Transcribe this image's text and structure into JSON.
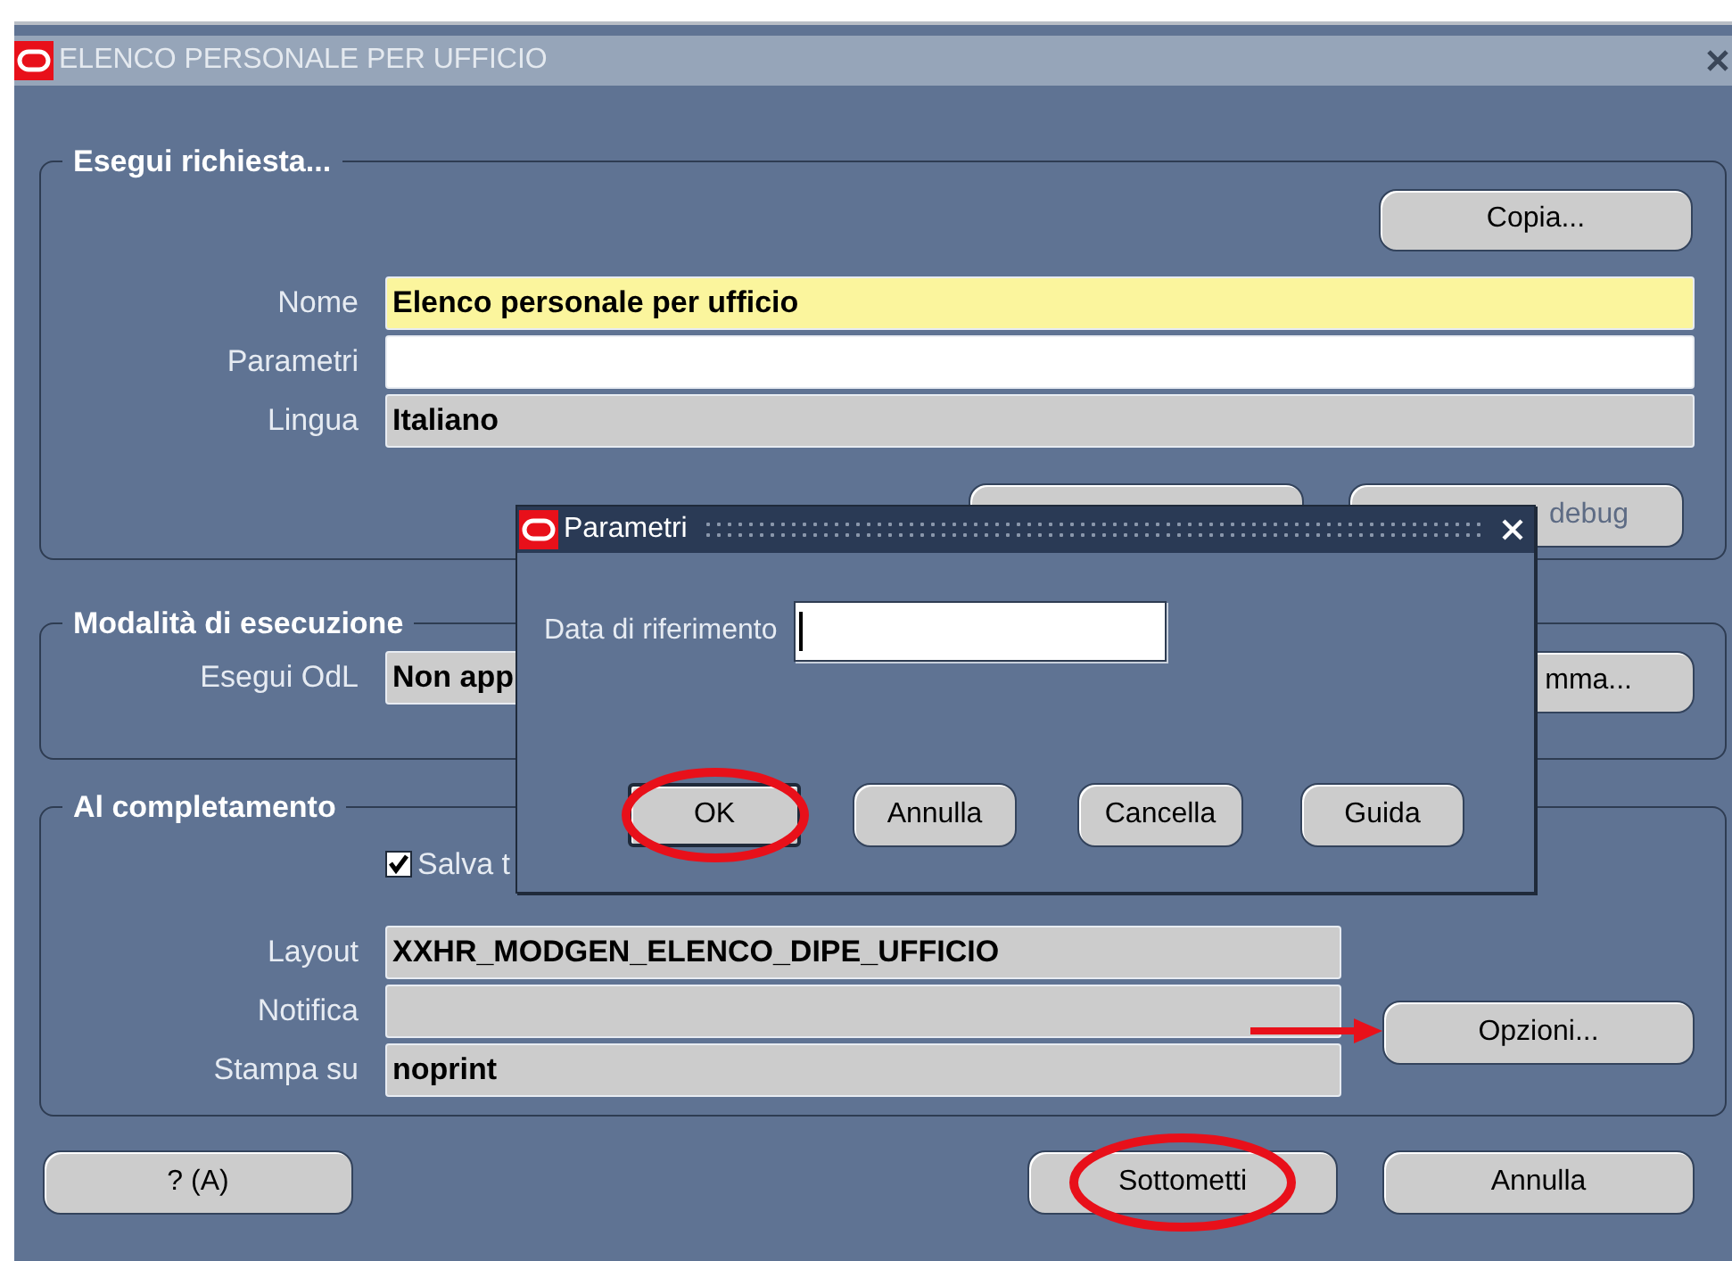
{
  "window": {
    "title": "ELENCO PERSONALE PER UFFICIO"
  },
  "request": {
    "legend": "Esegui richiesta...",
    "copy_button": "Copia...",
    "fields": [
      {
        "label": "Nome",
        "value": "Elenco personale per ufficio",
        "kind": "required"
      },
      {
        "label": "Parametri",
        "kind": "editable"
      },
      {
        "label": "Lingua",
        "value": "Italiano",
        "kind": "readonly"
      }
    ],
    "debug_button": {
      "label": "debug",
      "disabled": true
    }
  },
  "execution": {
    "legend": "Modalità di esecuzione",
    "field": {
      "label": "Esegui OdL",
      "value": "Non app"
    },
    "button": "mma..."
  },
  "completion": {
    "legend": "Al completamento",
    "checkbox": {
      "label": "Salva t",
      "checked": true
    },
    "fields": [
      {
        "label": "Layout",
        "value": "XXHR_MODGEN_ELENCO_DIPE_UFFICIO"
      },
      {
        "label": "Notifica"
      },
      {
        "label": "Stampa su",
        "value": "noprint"
      }
    ],
    "options_button": {
      "label": "Opzioni...",
      "arrow": true
    }
  },
  "footer_buttons": [
    {
      "label": "? (A)",
      "highlighted": false
    },
    {
      "label": "Sottometti",
      "highlighted": true
    },
    {
      "label": "Annulla",
      "highlighted": false
    }
  ],
  "dialog": {
    "title": "Parametri",
    "field": {
      "label": "Data di riferimento",
      "focused": true
    },
    "buttons": [
      {
        "label": "OK",
        "default": true,
        "highlighted": true
      },
      {
        "label": "Annulla",
        "default": false,
        "highlighted": false
      },
      {
        "label": "Cancella",
        "default": false,
        "highlighted": false
      },
      {
        "label": "Guida",
        "default": false,
        "highlighted": false
      }
    ]
  }
}
